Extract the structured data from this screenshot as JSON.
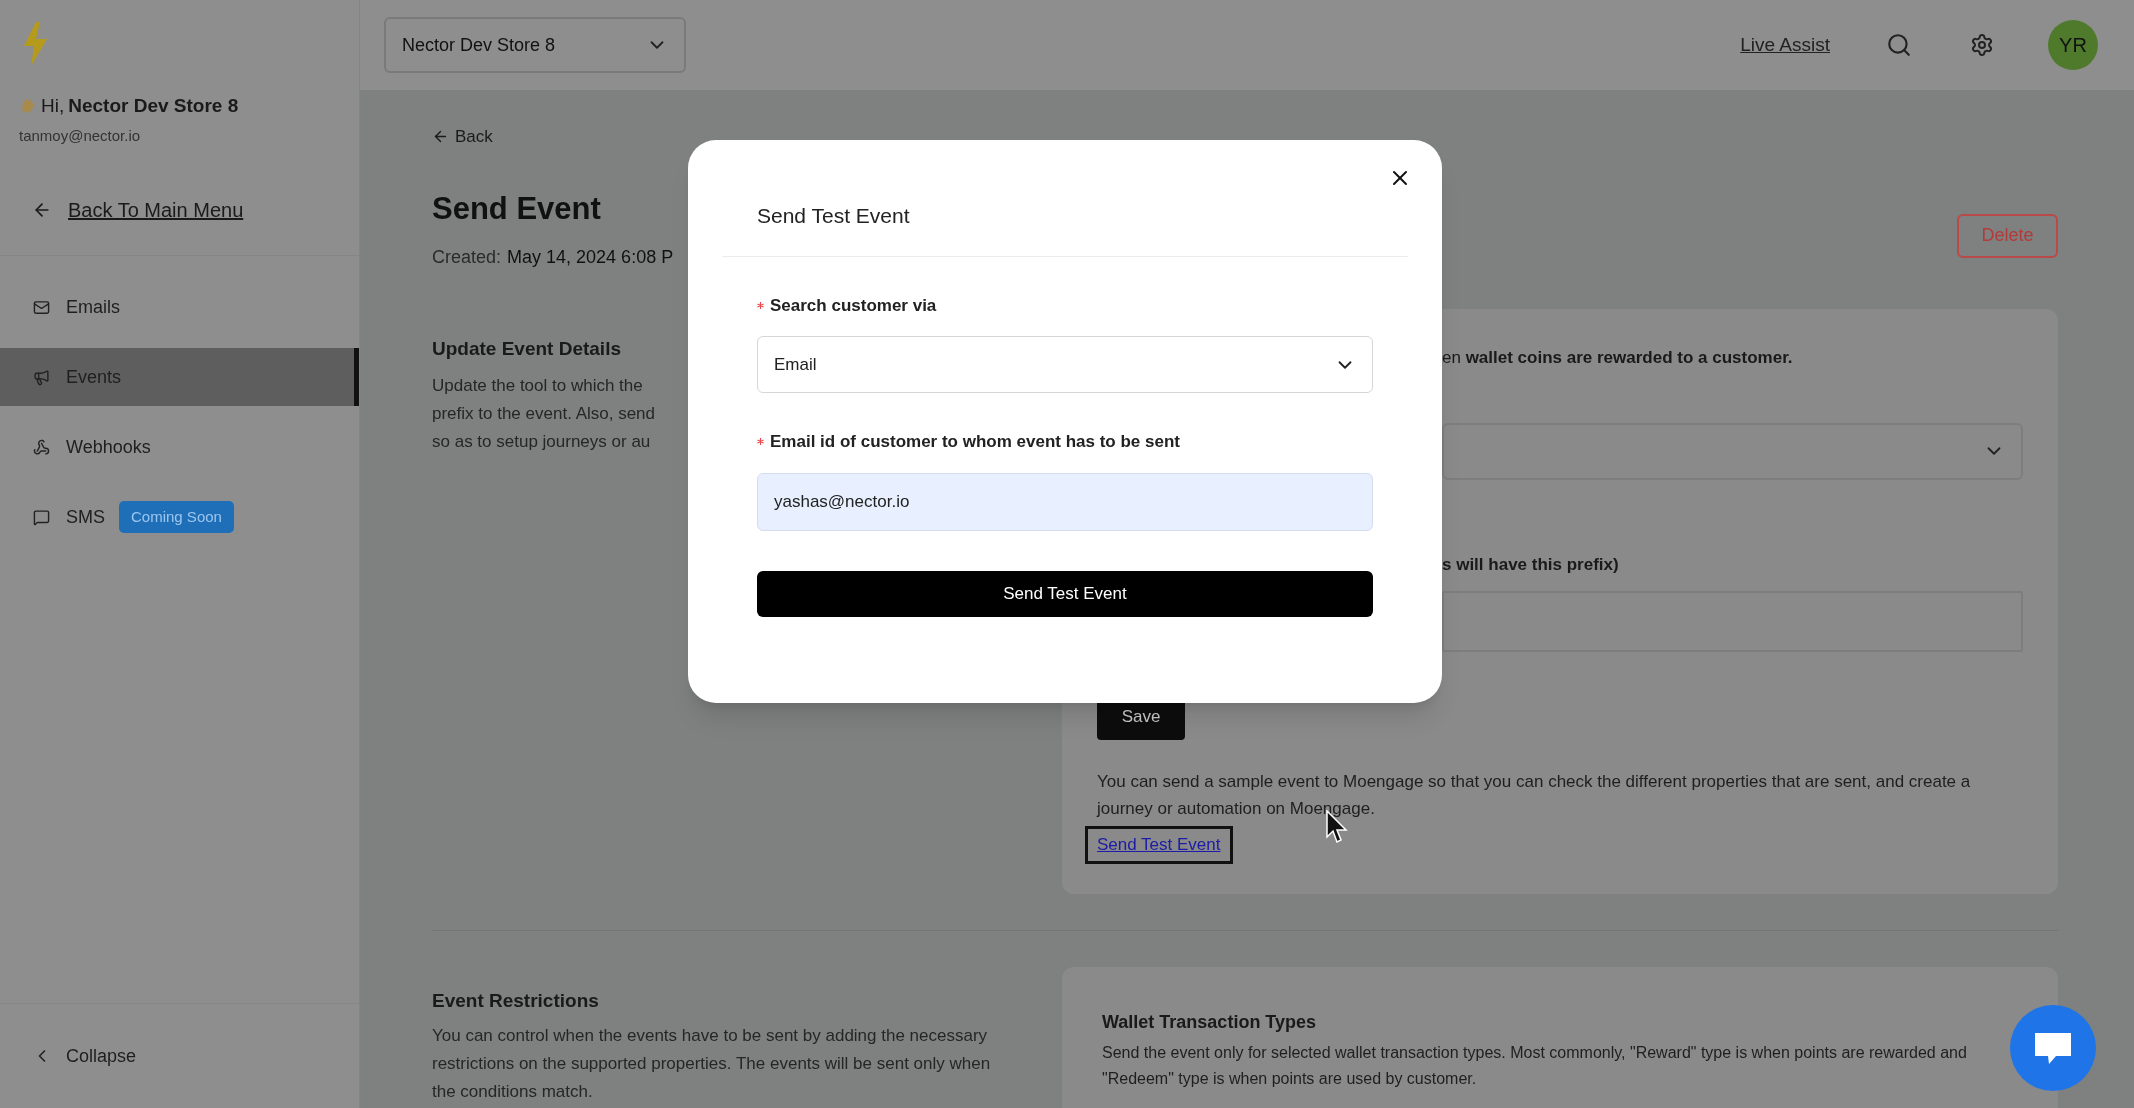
{
  "header": {
    "store_select": {
      "value": "Nector Dev Store 8"
    },
    "live_assist": "Live Assist",
    "avatar": "YR"
  },
  "sidebar": {
    "greeting": "Hi,",
    "store_name": "Nector Dev Store 8",
    "email": "tanmoy@nector.io",
    "back_link": "Back To Main Menu",
    "items": [
      {
        "label": "Emails",
        "selected": false
      },
      {
        "label": "Events",
        "selected": true
      },
      {
        "label": "Webhooks",
        "selected": false
      },
      {
        "label": "SMS",
        "selected": false,
        "badge": "Coming Soon"
      }
    ],
    "collapse": "Collapse"
  },
  "main": {
    "back": "Back",
    "title": "Send Event",
    "created_label": "Created:",
    "created_value": "May 14, 2024 6:08 P",
    "delete": "Delete",
    "update_section": {
      "heading": "Update Event Details",
      "description_lines": [
        "Update the tool to which the",
        "prefix to the event. Also, send",
        "so as to setup journeys or au"
      ],
      "card": {
        "line_1": "en **wallet coins are rewarded to a customer.**",
        "label_2": "s will have this prefix)",
        "save": "Save",
        "note": "You can send a sample event to Moengage so that you can check the different properties that are sent, and create a journey or automation on Moengage.",
        "send_test_link": "Send Test Event"
      }
    },
    "restrictions_section": {
      "heading": "Event Restrictions",
      "description": "You can control when the events have to be sent by adding the necessary restrictions on the supported properties. The events will be sent only when the conditions match.",
      "card": {
        "heading": "Wallet Transaction Types",
        "description": "Send the event only for selected wallet transaction types. Most commonly, \"Reward\" type is when points are rewarded and \"Redeem\" type is when points are used by customer."
      }
    }
  },
  "modal": {
    "title": "Send Test Event",
    "fields": [
      {
        "kind": "select",
        "label": "Search customer via",
        "required": true,
        "value": "Email"
      },
      {
        "kind": "input",
        "label": "Email id of customer to whom event has to be sent",
        "required": true,
        "value": "yashas@nector.io"
      }
    ],
    "submit": "Send Test Event"
  }
}
